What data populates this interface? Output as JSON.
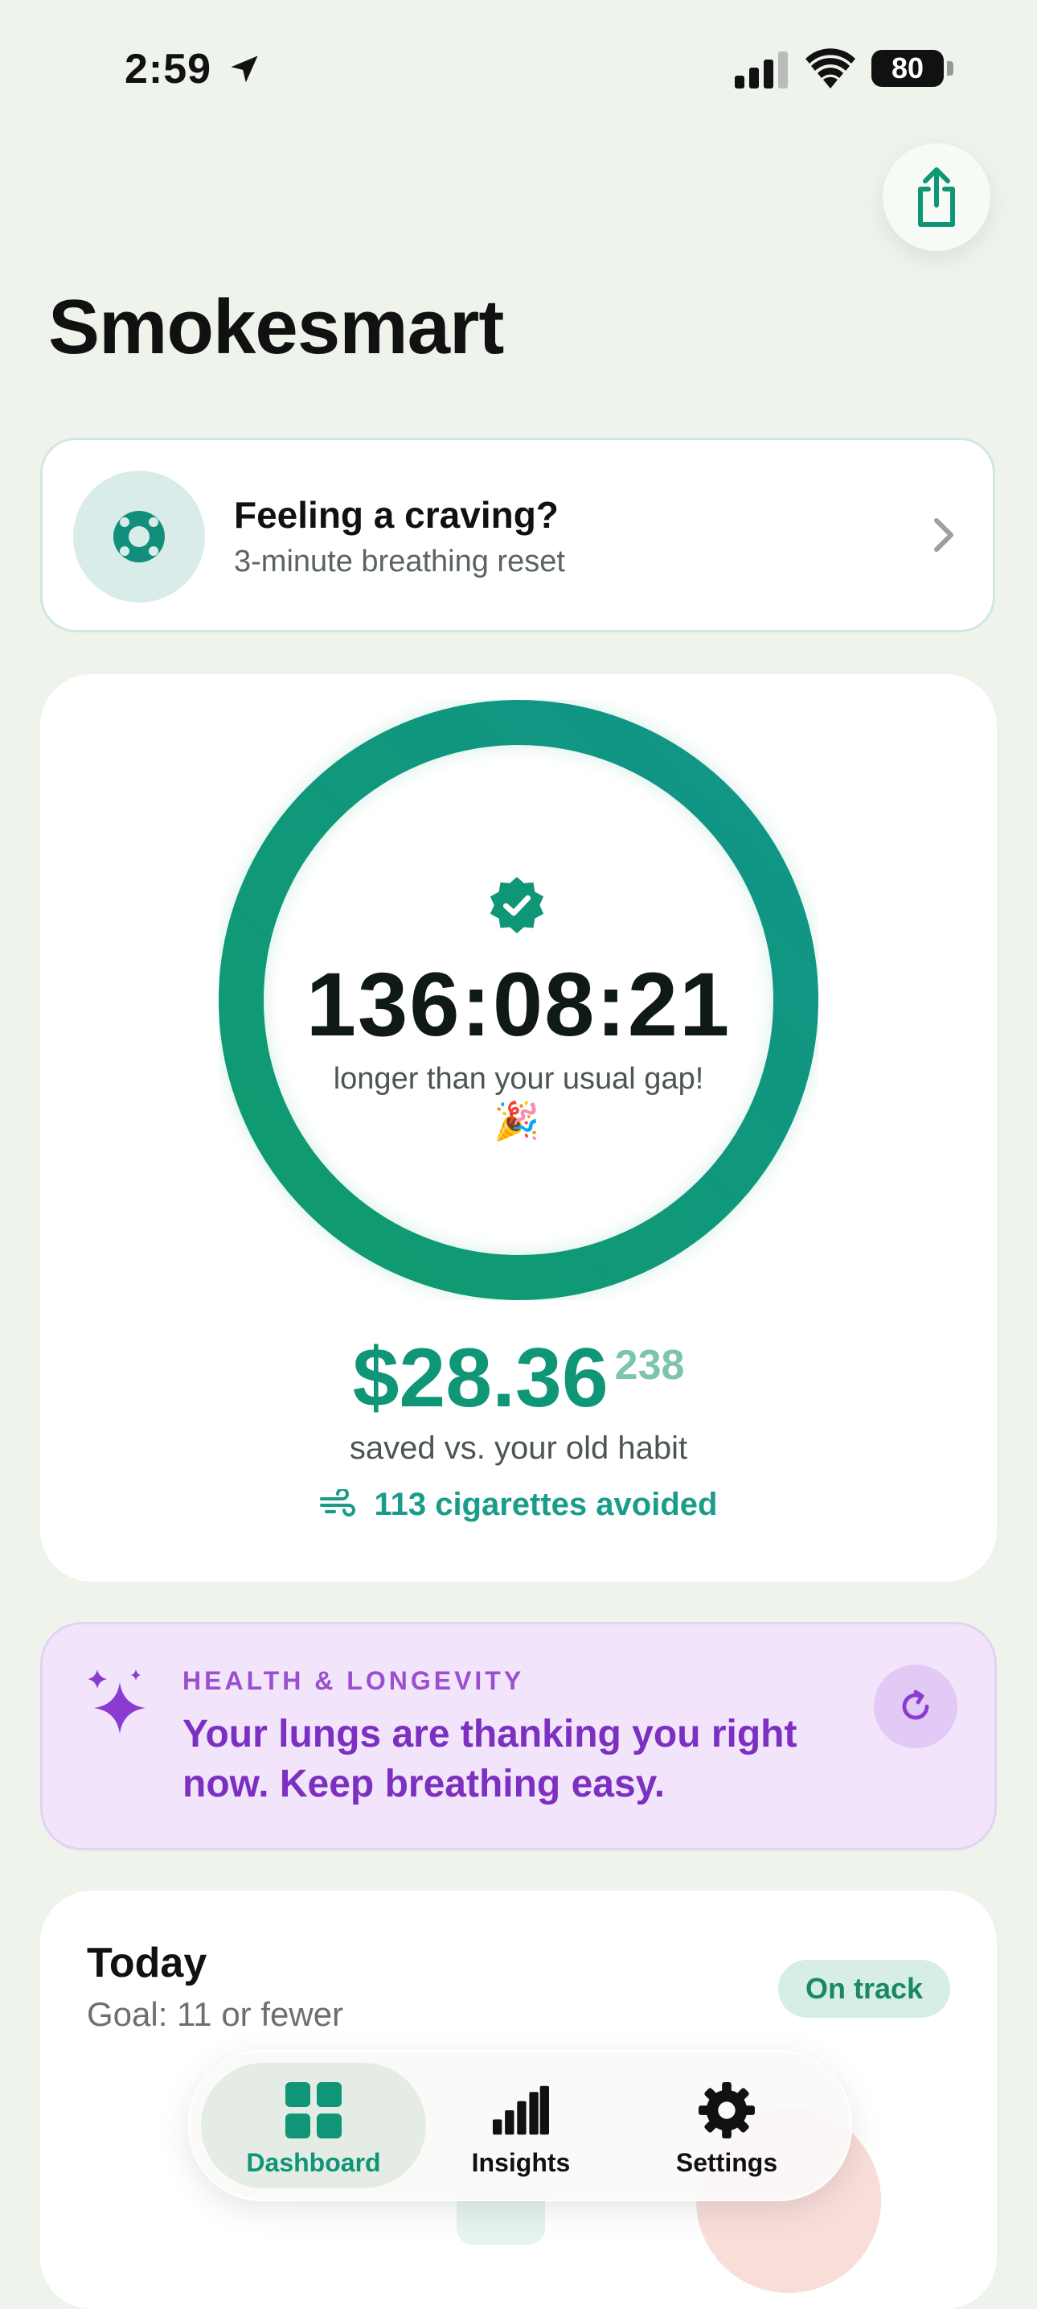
{
  "status_bar": {
    "time": "2:59",
    "battery": "80"
  },
  "header": {
    "title": "Smokesmart"
  },
  "craving_card": {
    "title": "Feeling a craving?",
    "subtitle": "3-minute breathing reset"
  },
  "timer_card": {
    "timer": "136:08:21",
    "caption": "longer than your usual gap!",
    "emoji": "🎉",
    "money_main": "$28.36",
    "money_fraction": "238",
    "saved_caption": "saved vs. your old habit",
    "cigarettes_avoided": "113 cigarettes avoided",
    "ring_progress": 1.0
  },
  "health_card": {
    "tag": "HEALTH & LONGEVITY",
    "message": "Your lungs are thanking you right now. Keep breathing easy."
  },
  "today_card": {
    "title": "Today",
    "goal": "Goal: 11 or fewer",
    "status": "On track"
  },
  "tab_bar": {
    "tabs": [
      {
        "label": "Dashboard",
        "icon": "grid-icon",
        "active": true
      },
      {
        "label": "Insights",
        "icon": "bar-chart-icon",
        "active": false
      },
      {
        "label": "Settings",
        "icon": "gear-icon",
        "active": false
      }
    ]
  },
  "colors": {
    "accent_green": "#0f9676",
    "purple": "#7c2fc0",
    "background": "#eef3ec"
  }
}
